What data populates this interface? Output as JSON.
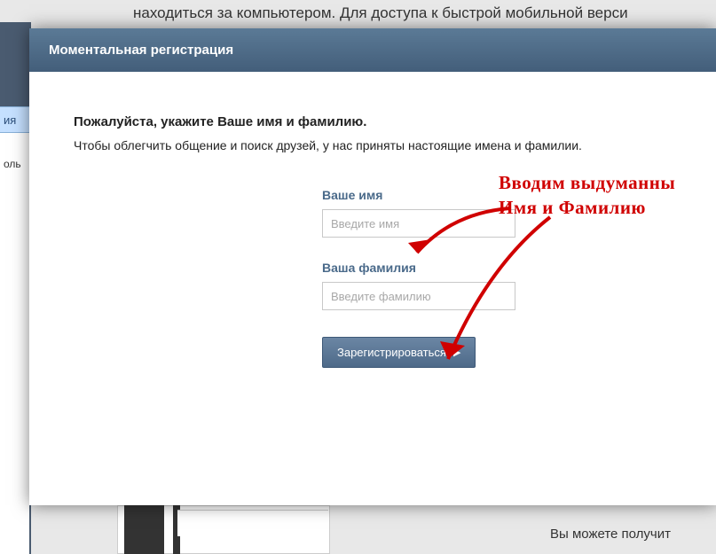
{
  "background": {
    "top_text": "находиться за компьютером. Для доступа к быстрой мобильной верси",
    "tab_fragment": "ия",
    "label_fragment": "оль",
    "bottom_text": "Вы можете получит"
  },
  "modal": {
    "title": "Моментальная регистрация",
    "prompt_title": "Пожалуйста, укажите Ваше имя и фамилию.",
    "prompt_sub": "Чтобы облегчить общение и поиск друзей, у нас приняты настоящие имена и фамилии.",
    "name_label": "Ваше имя",
    "name_placeholder": "Введите имя",
    "name_value": "",
    "surname_label": "Ваша фамилия",
    "surname_placeholder": "Введите фамилию",
    "surname_value": "",
    "submit_label": "Зарегистрироваться"
  },
  "annotation": {
    "line1": "Вводим выдуманны",
    "line2": "Имя и Фамилию"
  }
}
